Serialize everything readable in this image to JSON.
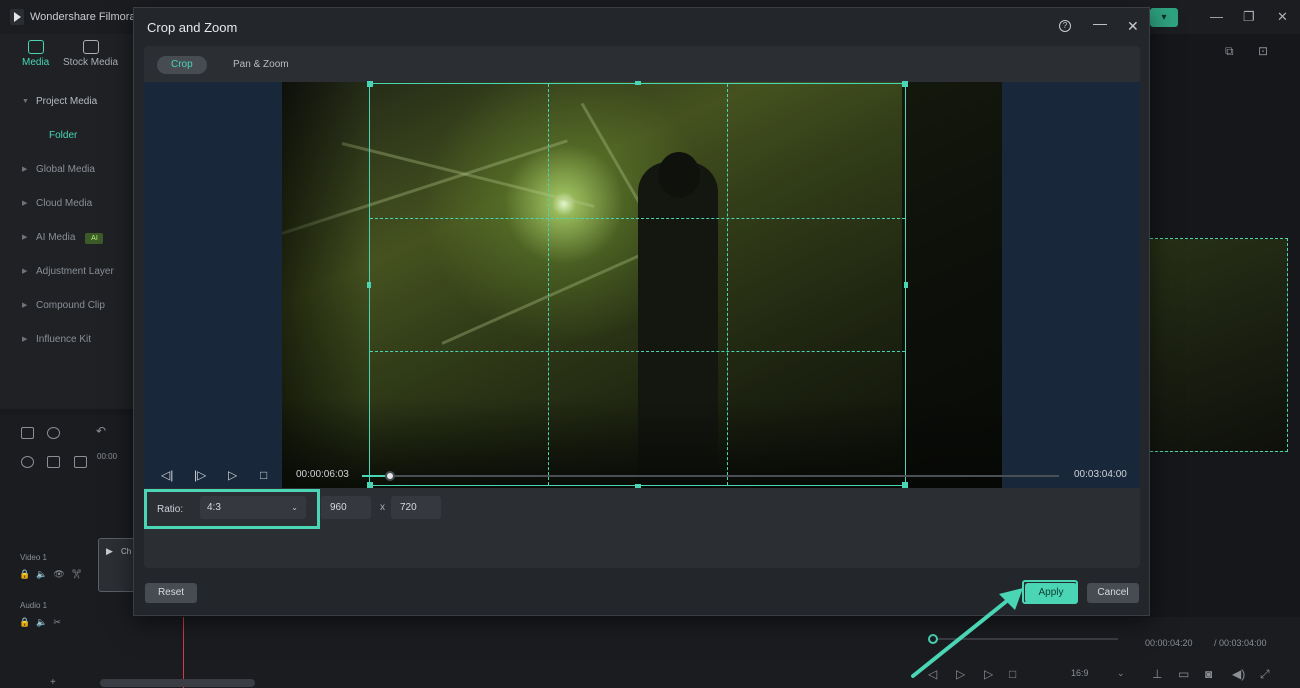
{
  "app": {
    "name": "Wondershare Filmora",
    "tabs": [
      {
        "label": "Media"
      },
      {
        "label": "Stock Media"
      }
    ],
    "sidebar": {
      "items": [
        {
          "label": "Project Media"
        },
        {
          "label": "Folder"
        },
        {
          "label": "Global Media"
        },
        {
          "label": "Cloud Media"
        },
        {
          "label": "AI Media",
          "badge": "AI"
        },
        {
          "label": "Adjustment Layer"
        },
        {
          "label": "Compound Clip"
        },
        {
          "label": "Influence Kit"
        }
      ]
    },
    "timeline": {
      "ruler_label": "00:00",
      "tracks": [
        {
          "label": "Video 1"
        },
        {
          "label": "Audio 1"
        }
      ],
      "clip_label": "Ch"
    },
    "preview": {
      "current_time": "00:00:04:20",
      "total_time": "/ 00:03:04:00",
      "aspect": "16:9"
    }
  },
  "dialog": {
    "title": "Crop and Zoom",
    "help_label": "?",
    "tabs": [
      {
        "label": "Crop",
        "active": true
      },
      {
        "label": "Pan & Zoom",
        "active": false
      }
    ],
    "player": {
      "current_time": "00:00:06:03",
      "total_time": "00:03:04:00",
      "progress": 0.04
    },
    "ratio": {
      "label": "Ratio:",
      "value": "4:3"
    },
    "width": "960",
    "height": "720",
    "dimension_separator": "x",
    "buttons": {
      "reset": "Reset",
      "apply": "Apply",
      "cancel": "Cancel"
    }
  },
  "colors": {
    "accent": "#4ad6b5",
    "dialog_bg": "#23262b",
    "panel_bg": "#2b2e33"
  }
}
